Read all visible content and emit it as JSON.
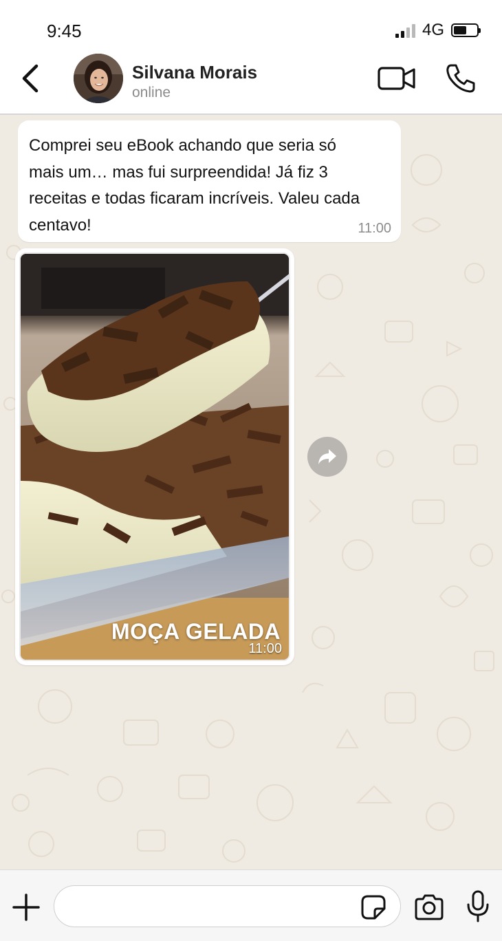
{
  "status_bar": {
    "time": "9:45",
    "network": "4G",
    "signal_bars_active": 2,
    "battery_level": 0.55
  },
  "header": {
    "contact_name": "Silvana Morais",
    "contact_status": "online",
    "icons": [
      "chevron-left-icon",
      "video-camera-icon",
      "phone-icon"
    ]
  },
  "messages": [
    {
      "type": "text",
      "text": "Comprei seu eBook achando que seria só mais um… mas fui surpreendida! Já fiz 3 receitas e todas ficaram incríveis. Valeu cada centavo!",
      "time": "11:00"
    },
    {
      "type": "image",
      "caption": "MOÇA GELADA",
      "time": "11:00"
    }
  ],
  "input_bar": {
    "placeholder": "",
    "icons": [
      "plus-icon",
      "sticker-icon",
      "camera-icon",
      "microphone-icon"
    ]
  },
  "colors": {
    "chat_background": "#efeae2",
    "bubble": "#ffffff",
    "timestamp": "#8c8c8c",
    "forward_button": "#b9b5b1"
  }
}
